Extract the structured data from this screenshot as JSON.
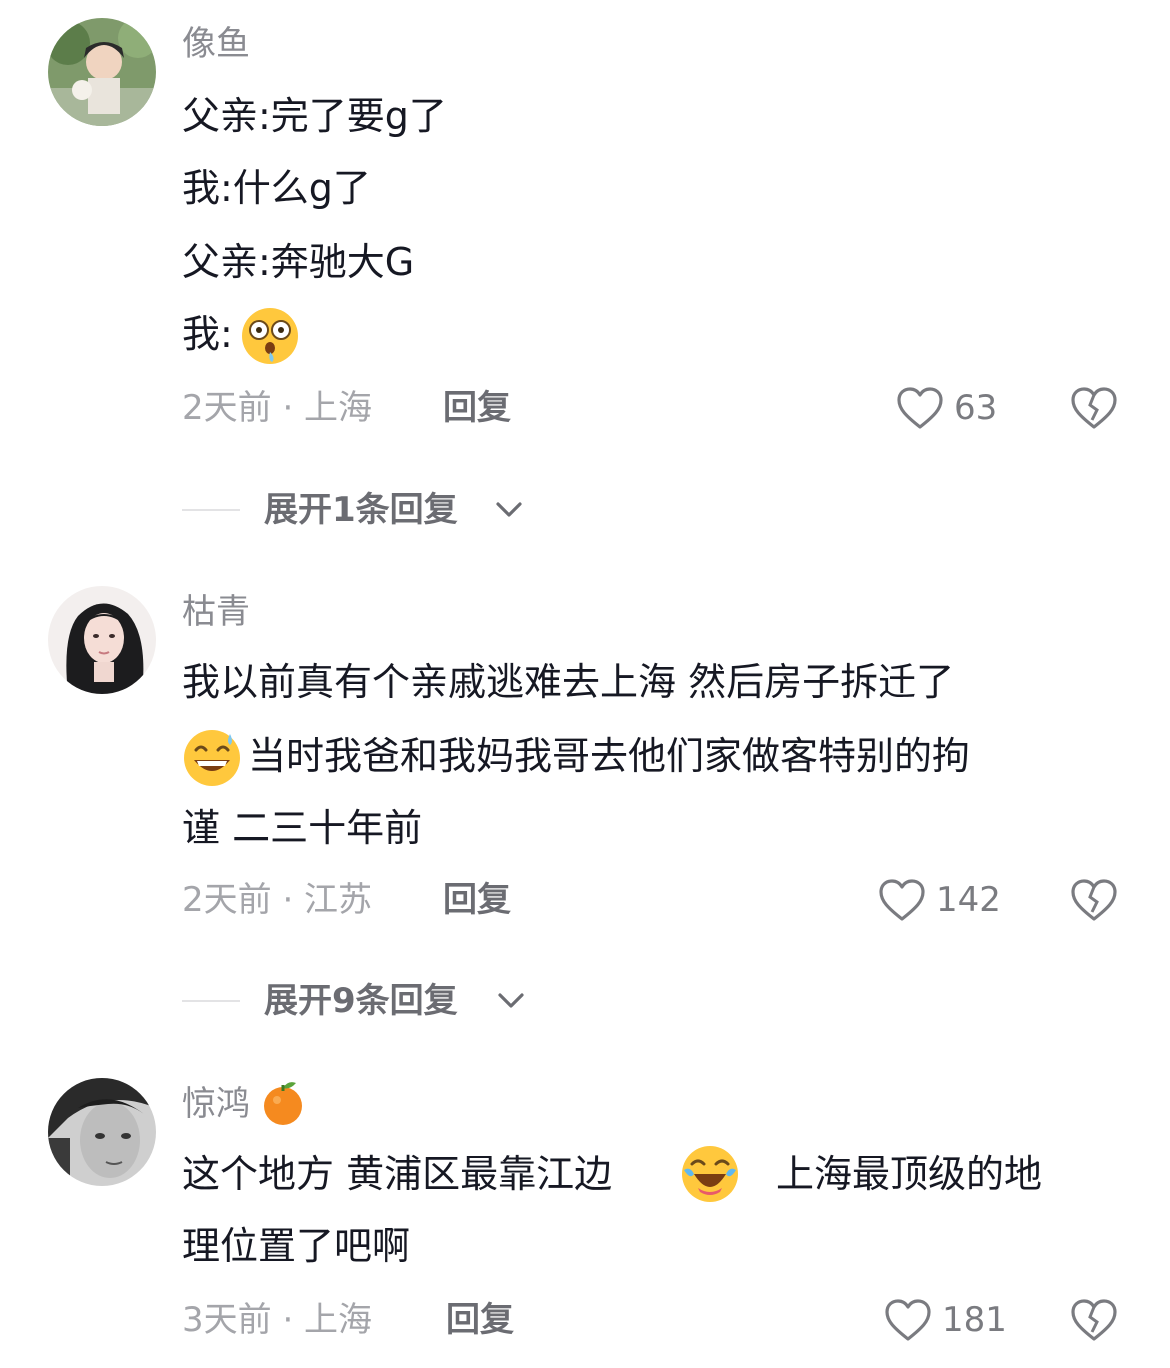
{
  "comments": [
    {
      "username": "像鱼",
      "lines": [
        "父亲:完了要g了",
        "我:什么g了",
        "父亲:奔驰大G",
        "我:"
      ],
      "line4_emoji": "astonished-drooling-emoji",
      "time": "2天前 · 上海",
      "reply": "回复",
      "likes": "63",
      "expand": "展开1条回复"
    },
    {
      "username": "枯青",
      "lines": [
        "我以前真有个亲戚逃难去上海 然后房子拆迁了",
        "当时我爸和我妈我哥去他们家做客特别的拘",
        "谨 二三十年前"
      ],
      "line2_emoji": "grinning-sweat-emoji",
      "time": "2天前 · 江苏",
      "reply": "回复",
      "likes": "142",
      "expand": "展开9条回复"
    },
    {
      "username": "惊鸿",
      "username_emoji": "tangerine-emoji",
      "lines_a": "这个地方 黄浦区最靠江边",
      "lines_b": "上海最顶级的地",
      "line2": "理位置了吧啊",
      "line1_emoji": "rolling-laughing-emoji",
      "time": "3天前 · 上海",
      "reply": "回复",
      "likes": "181"
    }
  ],
  "icons": {
    "like": "heart-outline-icon",
    "dislike": "broken-heart-icon",
    "expand": "chevron-down-icon"
  },
  "colors": {
    "text": "#161823",
    "meta": "#a4a5aa",
    "accent_gray": "#6b6c72"
  }
}
